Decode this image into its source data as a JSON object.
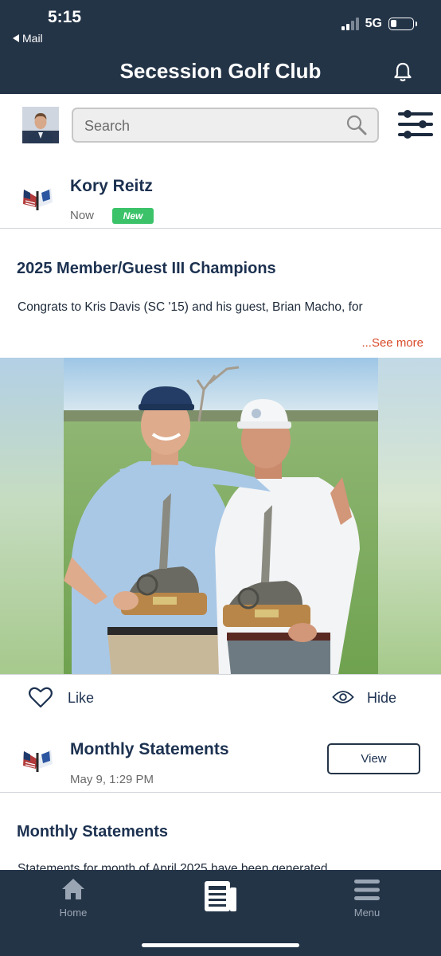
{
  "status_bar": {
    "time": "5:15",
    "back_app": "Mail",
    "network": "5G"
  },
  "header": {
    "title": "Secession Golf Club",
    "bell_icon": "bell-icon"
  },
  "search": {
    "placeholder": "Search",
    "search_icon": "search-icon",
    "filter_icon": "sliders-icon"
  },
  "feed": {
    "post1": {
      "author": "Kory Reitz",
      "time": "Now",
      "badge": "New",
      "title": "2025 Member/Guest III Champions",
      "text": "Congrats to Kris Davis (SC '15) and his guest, Brian Macho, for",
      "see_more": "...See more",
      "like_label": "Like",
      "hide_label": "Hide"
    },
    "post2": {
      "title": "Monthly Statements",
      "time": "May 9, 1:29 PM",
      "view_label": "View",
      "heading": "Monthly Statements",
      "text": "Statements for month of April 2025 have been generated"
    }
  },
  "tabbar": {
    "items": [
      {
        "label": "Home",
        "icon": "home-icon"
      },
      {
        "label": "",
        "icon": "news-icon"
      },
      {
        "label": "Menu",
        "icon": "hamburger-icon"
      }
    ]
  },
  "colors": {
    "navy": "#243447",
    "accent_green": "#3cc36a",
    "see_more_red": "#d84b2a"
  }
}
